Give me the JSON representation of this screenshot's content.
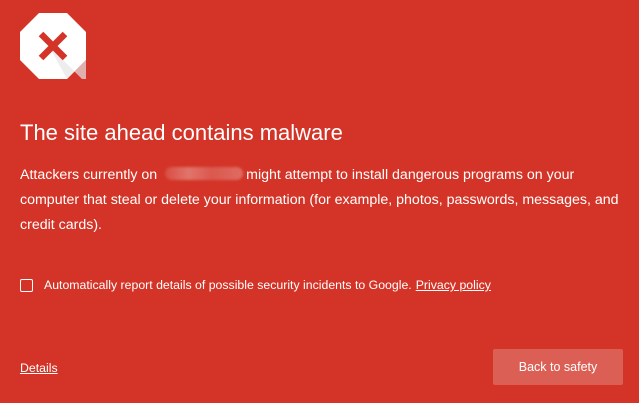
{
  "icon": "malware-stop-icon",
  "colors": {
    "background": "#d33427",
    "icon_fill": "#ffffff",
    "icon_mark": "#d33427",
    "button_bg": "#dc5f55"
  },
  "heading": "The site ahead contains malware",
  "message": {
    "before_site": "Attackers currently on",
    "after_site": "might attempt to install dangerous programs on your computer that steal or delete your information (for example, photos, passwords, messages, and credit cards)."
  },
  "report": {
    "checked": false,
    "label": "Automatically report details of possible security incidents to Google.",
    "privacy_link": "Privacy policy"
  },
  "details_link": "Details",
  "back_button": "Back to safety"
}
